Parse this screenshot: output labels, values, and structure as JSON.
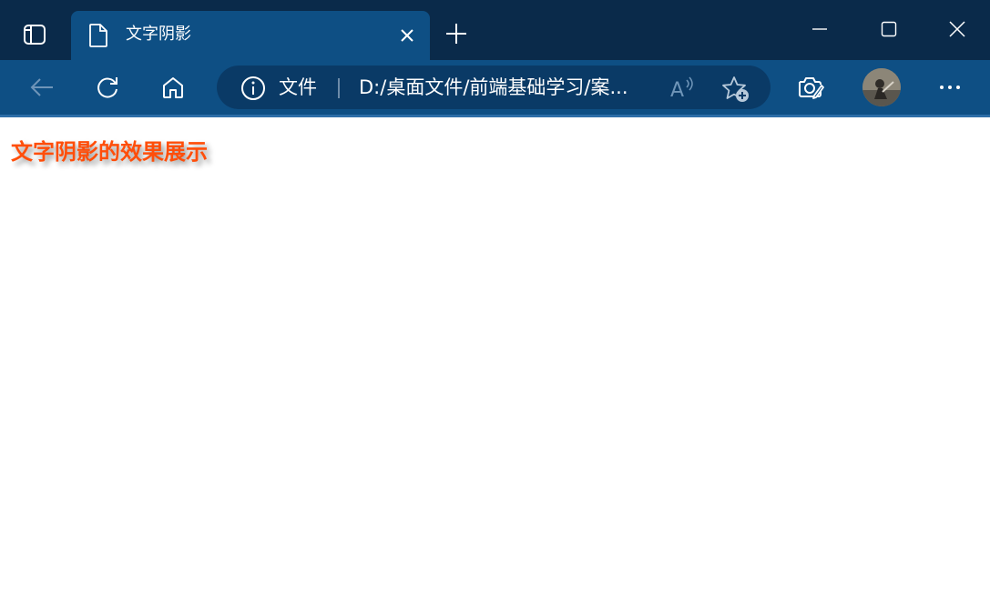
{
  "browser": {
    "tab": {
      "title": "文字阴影"
    },
    "address_bar": {
      "scheme_label": "文件",
      "url": "D:/桌面文件/前端基础学习/案..."
    },
    "icons": {
      "tab_actions": "tab-actions-icon",
      "tab_page": "page-icon",
      "tab_close": "close-icon",
      "new_tab": "plus-icon",
      "minimize": "minimize-icon",
      "maximize": "maximize-icon",
      "window_close": "close-icon",
      "back": "arrow-left-icon",
      "refresh": "refresh-icon",
      "home": "home-icon",
      "site_info": "info-icon",
      "read_aloud": "read-aloud-icon",
      "favorite": "favorite-add-icon",
      "screenshot": "screenshot-icon",
      "more": "more-icon"
    },
    "colors": {
      "titlebar": "#0a2a4a",
      "toolbar": "#0e4f84",
      "addressbar": "#0a3a66"
    }
  },
  "page": {
    "heading": "文字阴影的效果展示",
    "heading_color": "#ff4e0a",
    "shadow_color": "#9a9a9a"
  }
}
